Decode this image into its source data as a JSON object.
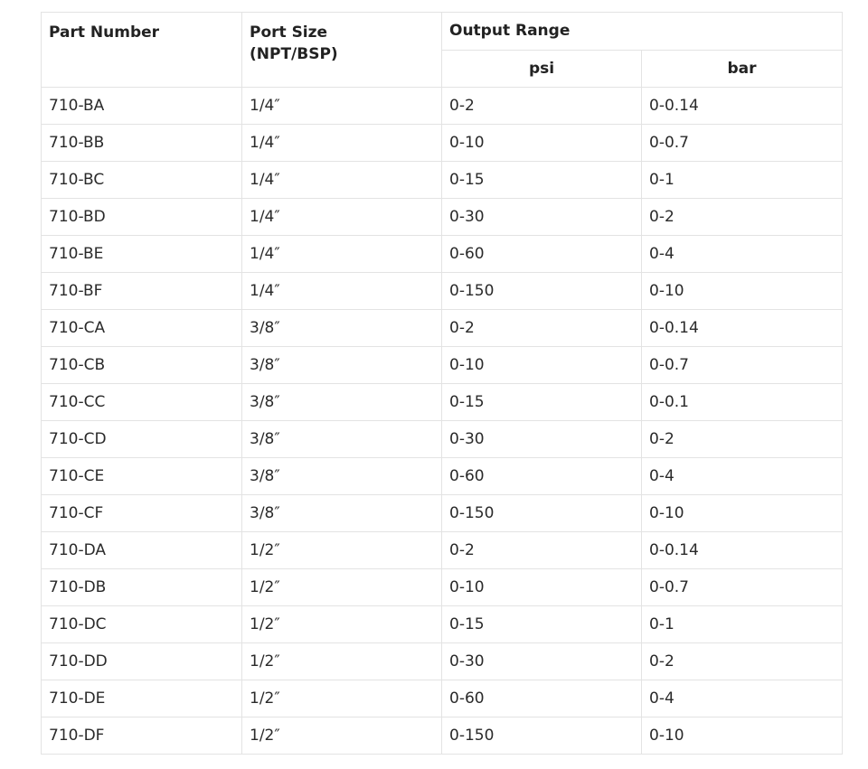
{
  "table": {
    "headers": {
      "part_number": "Part Number",
      "port_size_line1": "Port Size",
      "port_size_line2": "(NPT/BSP)",
      "output_range": "Output Range",
      "psi": "psi",
      "bar": "bar"
    },
    "rows": [
      {
        "part": "710-BA",
        "port": "1/4″",
        "psi": "0-2",
        "bar": "0-0.14"
      },
      {
        "part": "710-BB",
        "port": "1/4″",
        "psi": "0-10",
        "bar": "0-0.7"
      },
      {
        "part": "710-BC",
        "port": "1/4″",
        "psi": "0-15",
        "bar": "0-1"
      },
      {
        "part": "710-BD",
        "port": "1/4″",
        "psi": "0-30",
        "bar": "0-2"
      },
      {
        "part": "710-BE",
        "port": "1/4″",
        "psi": "0-60",
        "bar": "0-4"
      },
      {
        "part": "710-BF",
        "port": "1/4″",
        "psi": "0-150",
        "bar": "0-10"
      },
      {
        "part": "710-CA",
        "port": "3/8″",
        "psi": "0-2",
        "bar": "0-0.14"
      },
      {
        "part": "710-CB",
        "port": "3/8″",
        "psi": "0-10",
        "bar": "0-0.7"
      },
      {
        "part": "710-CC",
        "port": "3/8″",
        "psi": "0-15",
        "bar": "0-0.1"
      },
      {
        "part": "710-CD",
        "port": "3/8″",
        "psi": "0-30",
        "bar": "0-2"
      },
      {
        "part": "710-CE",
        "port": "3/8″",
        "psi": "0-60",
        "bar": "0-4"
      },
      {
        "part": "710-CF",
        "port": "3/8″",
        "psi": "0-150",
        "bar": "0-10"
      },
      {
        "part": "710-DA",
        "port": "1/2″",
        "psi": "0-2",
        "bar": "0-0.14"
      },
      {
        "part": "710-DB",
        "port": "1/2″",
        "psi": "0-10",
        "bar": "0-0.7"
      },
      {
        "part": "710-DC",
        "port": "1/2″",
        "psi": "0-15",
        "bar": "0-1"
      },
      {
        "part": "710-DD",
        "port": "1/2″",
        "psi": "0-30",
        "bar": "0-2"
      },
      {
        "part": "710-DE",
        "port": "1/2″",
        "psi": "0-60",
        "bar": "0-4"
      },
      {
        "part": "710-DF",
        "port": "1/2″",
        "psi": "0-150",
        "bar": "0-10"
      }
    ]
  }
}
